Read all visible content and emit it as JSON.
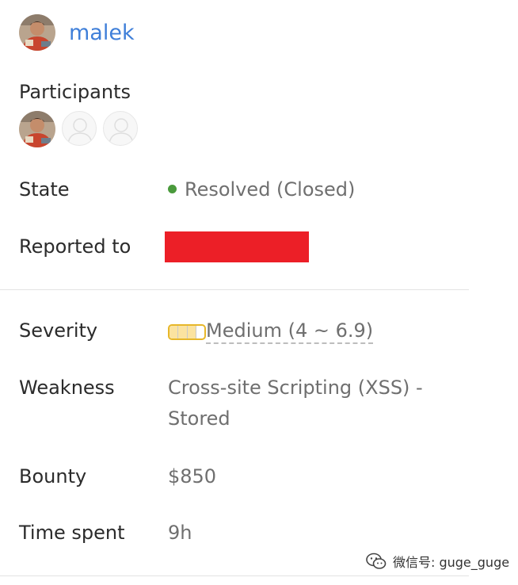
{
  "reporter": {
    "name": "malek",
    "avatar_icon": "user-avatar-photo"
  },
  "participants": {
    "label": "Participants",
    "avatars": [
      {
        "icon": "user-avatar-photo"
      },
      {
        "icon": "default-avatar-icon"
      },
      {
        "icon": "default-avatar-icon"
      }
    ]
  },
  "details": {
    "state": {
      "label": "State",
      "value": "Resolved (Closed)",
      "dot_color": "#4a9a3c"
    },
    "reported_to": {
      "label": "Reported to",
      "redaction_color": "#ec1f27"
    },
    "severity": {
      "label": "Severity",
      "value": "Medium (4 ~ 6.9)",
      "segments_filled": 3,
      "segments_total": 4,
      "accent": "#e7b72a"
    },
    "weakness": {
      "label": "Weakness",
      "value_line1": "Cross-site Scripting (XSS) -",
      "value_line2": "Stored"
    },
    "bounty": {
      "label": "Bounty",
      "value": "$850"
    },
    "time_spent": {
      "label": "Time spent",
      "value": "9h"
    }
  },
  "watermark": {
    "text": "微信号: guge_guge",
    "icon": "wechat-icon"
  }
}
